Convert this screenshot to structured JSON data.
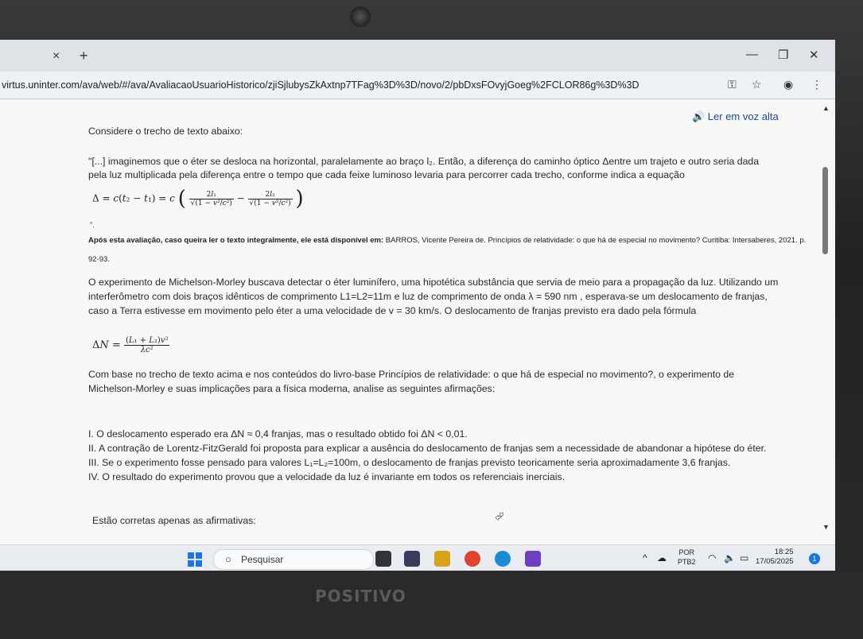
{
  "browser": {
    "tab_close": "×",
    "tab_new": "+",
    "url": "virtus.uninter.com/ava/web/#/ava/AvaliacaoUsuarioHistorico/zjiSjlubysZkAxtnp7TFag%3D%3D/novo/2/pbDxsFOvyjGoeg%2FCLOR86g%3D%3D"
  },
  "page": {
    "listen_label": "🔊 Ler em voz alta",
    "intro": "Considere o trecho de texto abaixo:",
    "quote_p1": "\"[...] imaginemos que o éter se desloca na horizontal, paralelamente ao braço l₂. Então, a diferença do caminho óptico Δentre um trajeto e outro seria dada",
    "quote_p2": "pela luz multiplicada pela diferença entre o tempo que cada feixe luminoso levaria para percorrer cada trecho, conforme indica a equação",
    "quote_end": "\".",
    "source_bold": "Após esta avaliação, caso queira ler o texto integralmente, ele está disponível em:",
    "source_ref": " BARROS, Vicente Pereira de. Princípios de relatividade: o que há de especial no movimento? Curitiba: Intersaberes, 2021. p.",
    "source_pages": "92-93.",
    "para1_l1": "O experimento de Michelson-Morley buscava detectar o éter luminífero, uma hipotética substância que servia de meio para a propagação da luz. Utilizando um",
    "para1_l2": "interferômetro com dois braços idênticos de comprimento L1=L2=11m e luz de comprimento de onda λ = 590 nm , esperava-se um deslocamento de franjas,",
    "para1_l3": "caso a Terra estivesse em movimento pelo éter a uma velocidade de v = 30 km/s. O deslocamento de franjas previsto era dado pela fórmula",
    "para2_l1": "Com base no trecho de texto acima e nos conteúdos do livro-base Princípios de relatividade: o que há de especial no movimento?, o experimento de",
    "para2_l2": "Michelson-Morley e suas implicações para a física moderna, analise as seguintes afirmações:",
    "item1": "I. O deslocamento esperado era ΔN ≈ 0,4 franjas, mas o resultado obtido foi ΔN < 0,01.",
    "item2": "II. A contração de Lorentz-FitzGerald foi proposta para explicar a ausência do deslocamento de franjas sem a necessidade de abandonar a hipótese do éter.",
    "item3": "III. Se o experimento fosse pensado para valores L₁=L₂=100m, o deslocamento de franjas previsto teoricamente seria aproximadamente 3,6 franjas.",
    "item4": "IV. O resultado do experimento provou que a velocidade da luz é invariante em todos os referenciais inerciais.",
    "question": "Estão corretas apenas as afirmativas:"
  },
  "taskbar": {
    "search_placeholder": "Pesquisar",
    "lang_1": "POR",
    "lang_2": "PTB2",
    "time": "18:25",
    "date": "17/05/2025"
  },
  "device": {
    "brand": "POSITIVO"
  }
}
